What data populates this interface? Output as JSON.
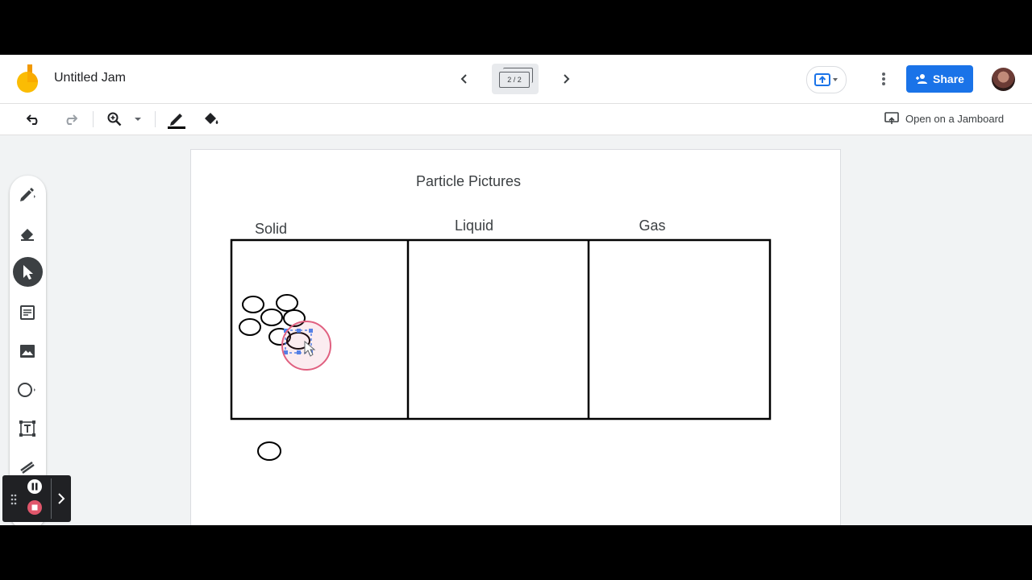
{
  "header": {
    "title": "Untitled Jam",
    "frame_counter": "2 / 2",
    "share_label": "Share"
  },
  "toolbar": {
    "open_jamboard_label": "Open on a Jamboard"
  },
  "canvas": {
    "title": "Particle Pictures",
    "columns": [
      "Solid",
      "Liquid",
      "Gas"
    ]
  },
  "icons": {
    "undo": "undo-icon",
    "redo": "redo-icon",
    "zoom": "zoom-in-icon",
    "pen": "pen-icon",
    "fill": "fill-bucket-icon",
    "present": "present-icon",
    "more": "more-vert-icon",
    "share": "person-add-icon",
    "side_tools": [
      "pen-tool-icon",
      "eraser-icon",
      "select-cursor-icon",
      "sticky-note-icon",
      "image-icon",
      "circle-shape-icon",
      "text-box-icon",
      "laser-icon"
    ]
  },
  "colors": {
    "accent": "#1a73e8",
    "logo_yellow": "#fbbc04",
    "logo_orange": "#f29900",
    "selection": "#4285f4",
    "cursor_ring": "#e06080"
  }
}
